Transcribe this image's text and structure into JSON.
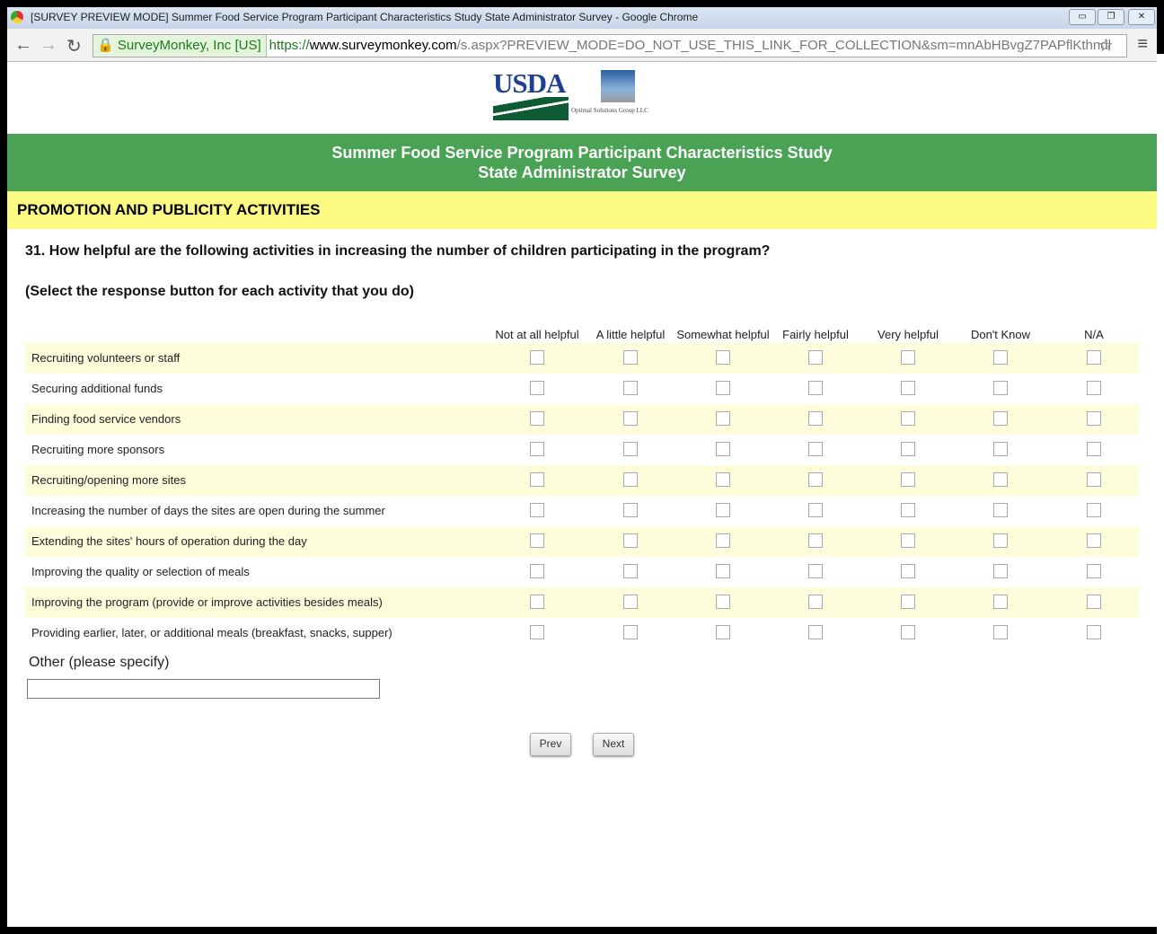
{
  "browser": {
    "title": "[SURVEY PREVIEW MODE] Summer Food Service Program Participant Characteristics Study State Administrator Survey - Google Chrome",
    "ev_label": "SurveyMonkey, Inc [US]",
    "url_scheme": "https://",
    "url_host": "www.surveymonkey.com",
    "url_path": "/s.aspx?PREVIEW_MODE=DO_NOT_USE_THIS_LINK_FOR_COLLECTION&sm=mnAbHBvgZ7PAPflKthndl"
  },
  "logos": {
    "usda": "USDA",
    "osg": "Optimal Solutions Group LLC"
  },
  "survey": {
    "title1": "Summer Food Service Program Participant Characteristics Study",
    "title2": "State Administrator Survey",
    "section": "PROMOTION AND PUBLICITY ACTIVITIES",
    "question": "31. How helpful are the following activities in increasing the number of children participating in the program?",
    "instruction": "(Select the response button for each activity that you do)",
    "columns": [
      "Not at all helpful",
      "A little helpful",
      "Somewhat helpful",
      "Fairly helpful",
      "Very helpful",
      "Don't Know",
      "N/A"
    ],
    "rows": [
      "Recruiting volunteers or staff",
      "Securing additional funds",
      "Finding food service vendors",
      "Recruiting more sponsors",
      "Recruiting/opening more sites",
      "Increasing the number of days the sites are open during the summer",
      "Extending the sites' hours of operation during the day",
      "Improving the quality or selection of meals",
      "Improving the program (provide or improve activities besides meals)",
      "Providing earlier, later, or additional meals (breakfast, snacks, supper)"
    ],
    "other_label": "Other (please specify)",
    "other_value": "",
    "prev": "Prev",
    "next": "Next"
  }
}
